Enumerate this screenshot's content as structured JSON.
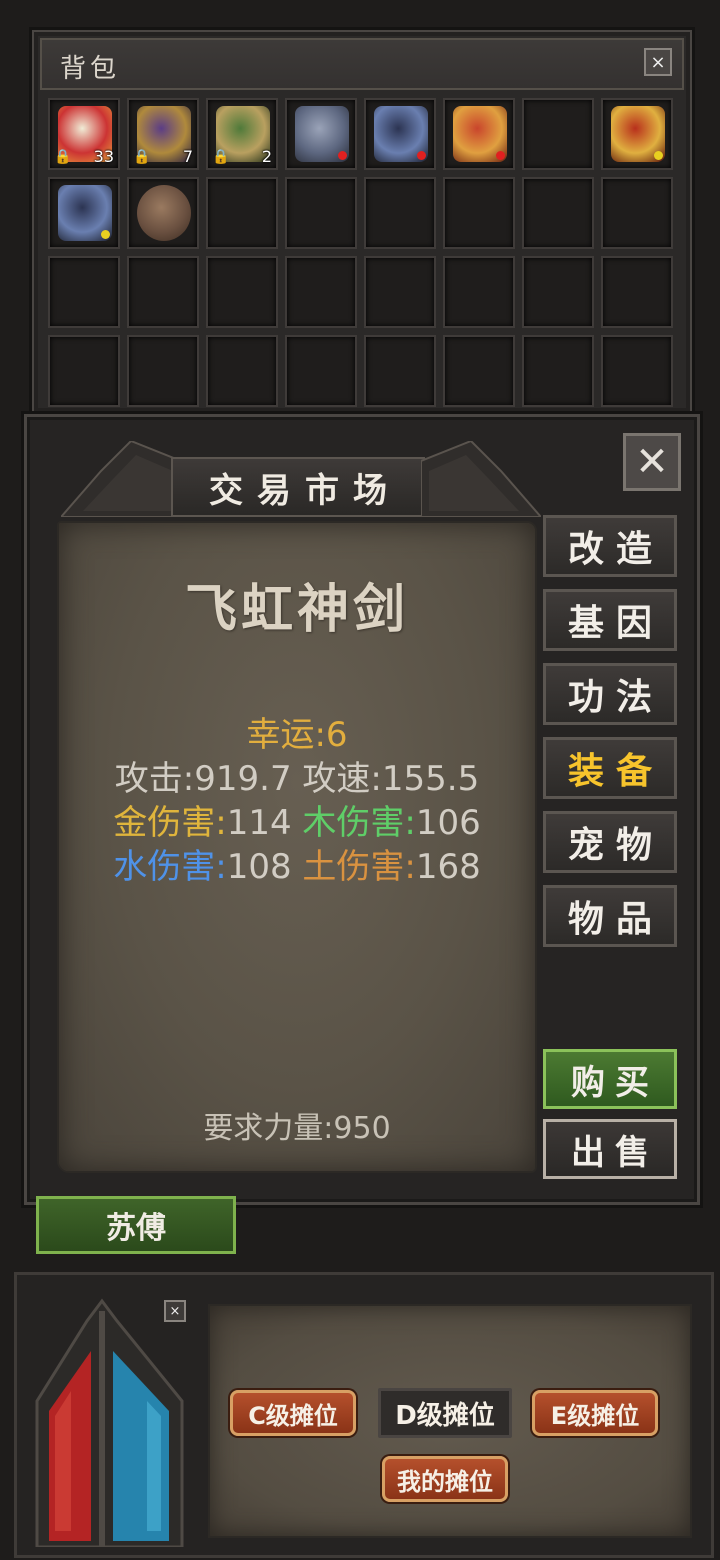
{
  "backpack": {
    "title": "背包",
    "close_label": "×",
    "slots": [
      {
        "icon": "tea-pack-icon",
        "qty": "33",
        "locked": true,
        "dot": "",
        "colors": [
          "#f0ecd6",
          "#c33",
          "#e9a23b"
        ]
      },
      {
        "icon": "scroll-purple-icon",
        "qty": "7",
        "locked": true,
        "dot": "",
        "colors": [
          "#5b3d86",
          "#b08a3c",
          "#2a2040"
        ]
      },
      {
        "icon": "scroll-green-icon",
        "qty": "2",
        "locked": true,
        "dot": "",
        "colors": [
          "#4f7a3a",
          "#b9a060",
          "#223018"
        ]
      },
      {
        "icon": "helmet-icon",
        "qty": "",
        "locked": false,
        "dot": "#e02020",
        "colors": [
          "#9aa3b8",
          "#5d6780",
          "#2a2e3a"
        ]
      },
      {
        "icon": "belt-icon",
        "qty": "",
        "locked": false,
        "dot": "#e02020",
        "colors": [
          "#2c3452",
          "#6a7fb0",
          "#1a1d2a"
        ]
      },
      {
        "icon": "gloves-icon",
        "qty": "",
        "locked": false,
        "dot": "#e02020",
        "colors": [
          "#c9452c",
          "#e0a040",
          "#6a1e10"
        ]
      },
      {
        "icon": "",
        "qty": "",
        "locked": false,
        "dot": "",
        "colors": []
      },
      {
        "icon": "armor-icon",
        "qty": "",
        "locked": false,
        "dot": "#e8d020",
        "colors": [
          "#b8301c",
          "#e0b040",
          "#5a1208"
        ]
      },
      {
        "icon": "belt-icon",
        "qty": "",
        "locked": false,
        "dot": "#e8d020",
        "colors": [
          "#2c3452",
          "#6a7fb0",
          "#1a1d2a"
        ]
      },
      {
        "icon": "fur-pelt-icon",
        "qty": "",
        "locked": false,
        "dot": "",
        "colors": [
          "#9a7a60",
          "#6a5040",
          "#3a2a20"
        ]
      },
      {
        "icon": "",
        "qty": "",
        "locked": false,
        "dot": "",
        "colors": []
      },
      {
        "icon": "",
        "qty": "",
        "locked": false,
        "dot": "",
        "colors": []
      },
      {
        "icon": "",
        "qty": "",
        "locked": false,
        "dot": "",
        "colors": []
      },
      {
        "icon": "",
        "qty": "",
        "locked": false,
        "dot": "",
        "colors": []
      },
      {
        "icon": "",
        "qty": "",
        "locked": false,
        "dot": "",
        "colors": []
      },
      {
        "icon": "",
        "qty": "",
        "locked": false,
        "dot": "",
        "colors": []
      },
      {
        "icon": "",
        "qty": "",
        "locked": false,
        "dot": "",
        "colors": []
      },
      {
        "icon": "",
        "qty": "",
        "locked": false,
        "dot": "",
        "colors": []
      },
      {
        "icon": "",
        "qty": "",
        "locked": false,
        "dot": "",
        "colors": []
      },
      {
        "icon": "",
        "qty": "",
        "locked": false,
        "dot": "",
        "colors": []
      },
      {
        "icon": "",
        "qty": "",
        "locked": false,
        "dot": "",
        "colors": []
      },
      {
        "icon": "",
        "qty": "",
        "locked": false,
        "dot": "",
        "colors": []
      },
      {
        "icon": "",
        "qty": "",
        "locked": false,
        "dot": "",
        "colors": []
      },
      {
        "icon": "",
        "qty": "",
        "locked": false,
        "dot": "",
        "colors": []
      },
      {
        "icon": "",
        "qty": "",
        "locked": false,
        "dot": "",
        "colors": []
      },
      {
        "icon": "",
        "qty": "",
        "locked": false,
        "dot": "",
        "colors": []
      },
      {
        "icon": "",
        "qty": "",
        "locked": false,
        "dot": "",
        "colors": []
      },
      {
        "icon": "",
        "qty": "",
        "locked": false,
        "dot": "",
        "colors": []
      },
      {
        "icon": "",
        "qty": "",
        "locked": false,
        "dot": "",
        "colors": []
      },
      {
        "icon": "",
        "qty": "",
        "locked": false,
        "dot": "",
        "colors": []
      },
      {
        "icon": "",
        "qty": "",
        "locked": false,
        "dot": "",
        "colors": []
      },
      {
        "icon": "",
        "qty": "",
        "locked": false,
        "dot": "",
        "colors": []
      }
    ]
  },
  "market": {
    "title": "交易市场",
    "close_label": "✕",
    "item": {
      "name": "飞虹神剑",
      "luck": "幸运:6",
      "attack_label": "攻击:",
      "attack_value": "919.7",
      "speed_label": "攻速:",
      "speed_value": "155.5",
      "gold_label": "金伤害:",
      "gold_value": "114",
      "wood_label": "木伤害:",
      "wood_value": "106",
      "water_label": "水伤害:",
      "water_value": "108",
      "earth_label": "土伤害:",
      "earth_value": "168",
      "requirement": "要求力量:950"
    },
    "categories": [
      {
        "label": "改造",
        "active": false
      },
      {
        "label": "基因",
        "active": false
      },
      {
        "label": "功法",
        "active": false
      },
      {
        "label": "装备",
        "active": true
      },
      {
        "label": "宠物",
        "active": false
      },
      {
        "label": "物品",
        "active": false
      }
    ],
    "buy_label": "购买",
    "sell_label": "出售"
  },
  "player_name": "苏傅",
  "stall": {
    "close_label": "×",
    "c_stall": "C级摊位",
    "d_stall": "D级摊位",
    "e_stall": "E级摊位",
    "my_stall": "我的摊位"
  },
  "colors": {
    "gold_stat": "#e0b53c",
    "wood_stat": "#5fce68",
    "water_stat": "#4f92e8",
    "earth_stat": "#d99240",
    "active_tab": "#f7c42c",
    "hp_orb": "#c22a2a",
    "mp_orb": "#2a8fb8"
  }
}
